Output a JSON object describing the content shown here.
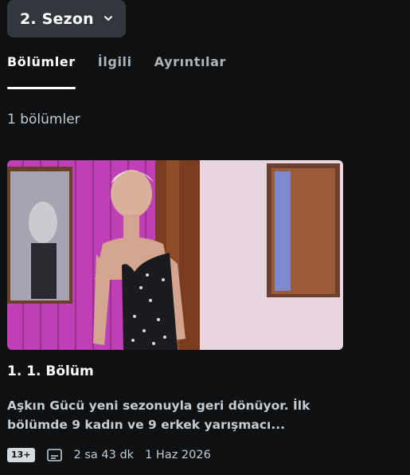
{
  "season_selector": {
    "label": "2. Sezon",
    "icon": "chevron-down-icon"
  },
  "tabs": [
    {
      "label": "Bölümler",
      "active": true
    },
    {
      "label": "İlgili",
      "active": false
    },
    {
      "label": "Ayrıntılar",
      "active": false
    }
  ],
  "episode_count": "1 bölümler",
  "episodes": [
    {
      "title": "1. 1. Bölüm",
      "description": "Aşkın Gücü yeni sezonuyla geri dönüyor. İlk bölümde 9 kadın ve 9 erkek yarışmacı...",
      "rating": "13+",
      "subtitle_icon": "subtitles-icon",
      "duration": "2 sa 43 dk",
      "air_date": "1 Haz 2026"
    }
  ],
  "colors": {
    "background": "#0f1012",
    "selector_bg": "#33373d",
    "secondary_text": "#c7ccd1",
    "inactive_tab": "#aeb4b9"
  }
}
